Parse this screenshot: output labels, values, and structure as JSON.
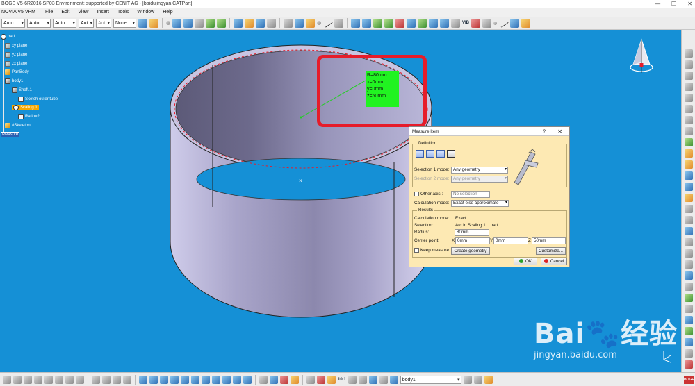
{
  "window": {
    "title": "BOGE V5-6R2016 SP03 Environment: supported by CENIT AG - [baidujingyan.CATPart]",
    "controls": [
      "—",
      "❐",
      "✕"
    ]
  },
  "menubar": {
    "app": "NOVIA V5 VPM",
    "items": [
      {
        "label": "File",
        "hotkey": "F"
      },
      {
        "label": "Edit",
        "hotkey": "E"
      },
      {
        "label": "View",
        "hotkey": "V"
      },
      {
        "label": "Insert",
        "hotkey": "I"
      },
      {
        "label": "Tools",
        "hotkey": "T"
      },
      {
        "label": "Window",
        "hotkey": "W"
      },
      {
        "label": "Help",
        "hotkey": "H"
      }
    ]
  },
  "toolbar": {
    "combos": [
      "Auto",
      "Auto",
      "Auto",
      "Aut",
      "Aut",
      "None"
    ],
    "vib_label": "VIB"
  },
  "tree": {
    "nodes": [
      {
        "label": "part",
        "icon": "gear-icon",
        "level": 0
      },
      {
        "label": "xy plane",
        "icon": "plane-icon",
        "level": 1
      },
      {
        "label": "yz plane",
        "icon": "plane-icon",
        "level": 1
      },
      {
        "label": "zx plane",
        "icon": "plane-icon",
        "level": 1
      },
      {
        "label": "PartBody",
        "icon": "body-icon",
        "level": 1
      },
      {
        "label": "body1",
        "icon": "body-icon",
        "level": 1
      },
      {
        "label": "Shaft.1",
        "icon": "shaft-icon",
        "level": 2
      },
      {
        "label": "Sketch outer tube",
        "icon": "sketch-icon",
        "level": 3
      },
      {
        "label": "Scaling.1",
        "icon": "scaling-icon",
        "level": 2,
        "selected": true
      },
      {
        "label": "Ratio=2",
        "icon": "parameter-icon",
        "level": 3
      },
      {
        "label": "#Skeleton",
        "icon": "skeleton-icon",
        "level": 1
      },
      {
        "label": "Measure",
        "icon": "measure-icon",
        "level": 0,
        "highlighted": true
      }
    ]
  },
  "annotation": {
    "lines": [
      "R=80mm",
      "x=0mm",
      "y=0mm",
      "z=50mm"
    ],
    "bg_color": "#21f321",
    "frame_color": "#e61c2a"
  },
  "dialog": {
    "title": "Measure Item",
    "help": "?",
    "close": "✕",
    "definition_label": "Definition",
    "selection1_label": "Selection 1 mode:",
    "selection1_value": "Any geometry",
    "selection2_label": "Selection 2 mode:",
    "selection2_value": "Any geometry",
    "other_axis_label": "Other axis :",
    "other_axis_value": "No selection",
    "calc_mode_label": "Calculation mode:",
    "calc_mode_value": "Exact else approximate",
    "results_label": "Results",
    "result_calc_label": "Calculation mode:",
    "result_calc_value": "Exact",
    "selection_label": "Selection:",
    "selection_value": "Arc in Scaling.1....part",
    "radius_label": "Radius:",
    "radius_value": "80mm",
    "center_label": "Center point:",
    "x_label": "X",
    "x_value": "0mm",
    "y_label": "Y",
    "y_value": "0mm",
    "z_label": "Z",
    "z_value": "50mm",
    "keep_label": "Keep measure",
    "create_geometry": "Create geometry",
    "customize": "Customize...",
    "ok": "OK",
    "cancel": "Cancel",
    "bg_color": "#fde9b3"
  },
  "bottom": {
    "body_combo": "body1",
    "scale_label": "10.1",
    "brand": "BOGE"
  },
  "watermark": {
    "logo": "Bai🐾经验",
    "url": "jingyan.baidu.com"
  },
  "colors": {
    "viewport_bg": "#1590d6",
    "cylinder": "#b8b4d6"
  }
}
